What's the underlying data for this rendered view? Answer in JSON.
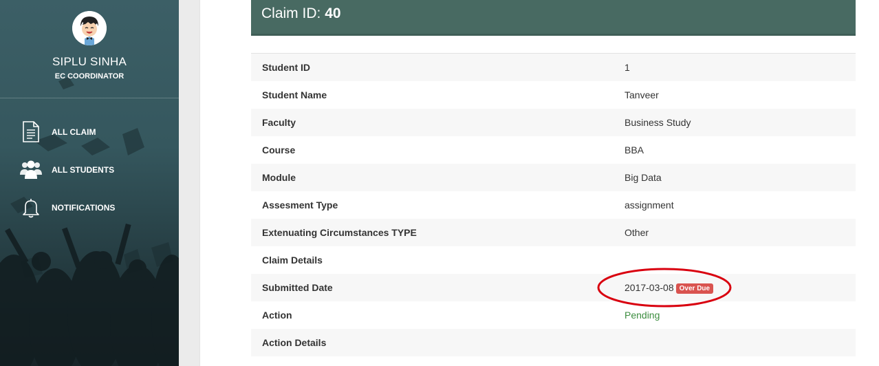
{
  "sidebar": {
    "profile": {
      "name": "SIPLU SINHA",
      "role": "EC COORDINATOR",
      "avatar_icon": "cartoon-avatar-icon"
    },
    "nav": [
      {
        "label": "ALL CLAIM",
        "icon": "document-icon"
      },
      {
        "label": "ALL STUDENTS",
        "icon": "users-icon"
      },
      {
        "label": "NOTIFICATIONS",
        "icon": "bell-icon"
      }
    ]
  },
  "claim": {
    "title_prefix": "Claim ID: ",
    "id": "40"
  },
  "details": [
    {
      "label": "Student ID",
      "value": "1"
    },
    {
      "label": "Student Name",
      "value": "Tanveer"
    },
    {
      "label": "Faculty",
      "value": "Business Study"
    },
    {
      "label": "Course",
      "value": "BBA"
    },
    {
      "label": "Module",
      "value": "Big Data"
    },
    {
      "label": "Assesment Type",
      "value": "assignment"
    },
    {
      "label": "Extenuating Circumstances TYPE",
      "value": "Other"
    },
    {
      "label": "Claim Details",
      "value": ""
    },
    {
      "label": "Submitted Date",
      "value": "2017-03-08",
      "badge": "Over Due"
    },
    {
      "label": "Action",
      "value": "Pending"
    },
    {
      "label": "Action Details",
      "value": ""
    }
  ],
  "colors": {
    "header": "#486a62",
    "overdue_badge": "#d9534f",
    "pending_text": "#3c8d3f",
    "highlight_ring": "#d9000f"
  }
}
